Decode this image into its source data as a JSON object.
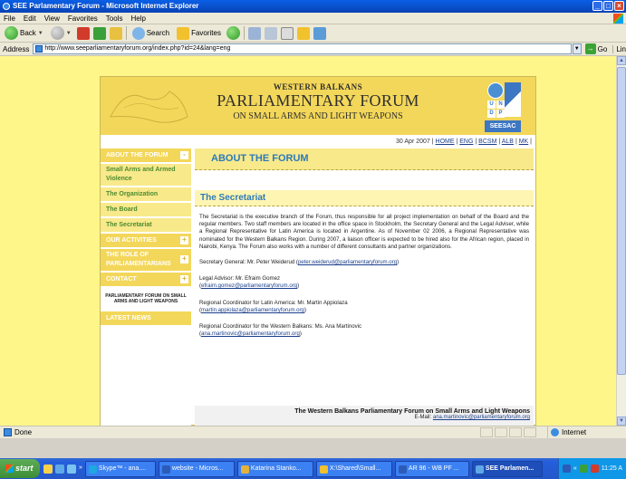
{
  "window": {
    "title": "SEE Parlamentary Forum - Microsoft Internet Explorer",
    "buttons": [
      "_",
      "□",
      "×"
    ]
  },
  "menu": [
    "File",
    "Edit",
    "View",
    "Favorites",
    "Tools",
    "Help"
  ],
  "toolbar": {
    "back": "Back",
    "search": "Search",
    "favorites": "Favorites"
  },
  "address": {
    "label": "Address",
    "url": "http://www.seeparliamentaryforum.org/index.php?id=24&lang=eng",
    "go": "Go",
    "links": "Lin"
  },
  "banner": {
    "line1": "WESTERN BALKANS",
    "line2": "PARLIAMENTARY FORUM",
    "line3": "ON SMALL ARMS AND LIGHT WEAPONS",
    "undp_letters": [
      "U",
      "N",
      "D",
      "P"
    ],
    "seesac": "SEESAC"
  },
  "daterow": {
    "date": "30 Apr 2007",
    "sep": "|",
    "links": [
      "HOME",
      "ENG",
      "BCSM",
      "ALB",
      "MK"
    ]
  },
  "nav": {
    "about": "ABOUT THE FORUM",
    "sub1": "Small Arms and Armed Violence",
    "sub2": "The Organization",
    "sub3": "The Board",
    "sub4": "The Secretariat",
    "activities": "OUR ACTIVITIES",
    "role": "THE ROLE OF PARLIAMENTARIANS",
    "contact": "CONTACT",
    "mini": "PARLIAMENTARY FORUM ON SMALL ARMS AND LIGHT WEAPONS",
    "news": "LATEST NEWS",
    "plus": "+",
    "minus": "-"
  },
  "content": {
    "heading": "ABOUT THE FORUM",
    "section_title": "The Secretariat",
    "paragraph": "The Secretariat is the executive branch of the Forum, thus responsible for all project implementation on behalf of the Board and the regular members. Two staff members are located in the office space in Stockholm, the Secretary General and the Legal Adviser, while a Regional Representative for Latin America is located in Argentine. As of November 02 2006, a Regional Representative was nominated for the Western Balkans Region. During 2007, a liaison officer is expected to be hired also for the African region, placed in Nairobi, Kenya. The Forum also works with a number of different consultants and partner organizations.",
    "contacts": [
      {
        "label": "Secretary General: Mr. Peter Weiderud",
        "email": "peter.weiderud@parliamentaryforum.org"
      },
      {
        "label": "Legal Advisor: Mr. Efraim Gomez",
        "email": "efraim.gomez@parliamentaryforum.org"
      },
      {
        "label": "Regional Coordinator for Latin America: Mr. Martin Appiolaza",
        "email": "martin.appiolaza@parliamentaryforum.org"
      },
      {
        "label": "Regional Coordinator for the Western Balkans: Ms. Ana Martinovic",
        "email": "ana.martinovic@parliamentaryforum.org"
      }
    ],
    "footer_title": "The Western Balkans Parliamentary Forum on Small Arms and Light Weapons",
    "footer_email_label": "E-Mail:",
    "footer_email": "ana.martinovic@parliamentaryforum.org"
  },
  "status": {
    "left": "Done",
    "zone": "Internet"
  },
  "taskbar": {
    "start": "start",
    "overflow": "»",
    "tasks": [
      "Skype™ - ana....",
      "website - Micros...",
      "Katarina Stanko...",
      "X:\\Shared\\Small...",
      "AR 96 - WB PF ...",
      "SEE Parlamen..."
    ],
    "tray_overflow": "«",
    "clock": "11:25 A"
  },
  "colors": {
    "banner": "#F3D75A",
    "page_bg": "#FFF68A",
    "heading_blue": "#2E7AB8",
    "nav_green": "#4B8B2E",
    "link": "#1A3F8A"
  }
}
